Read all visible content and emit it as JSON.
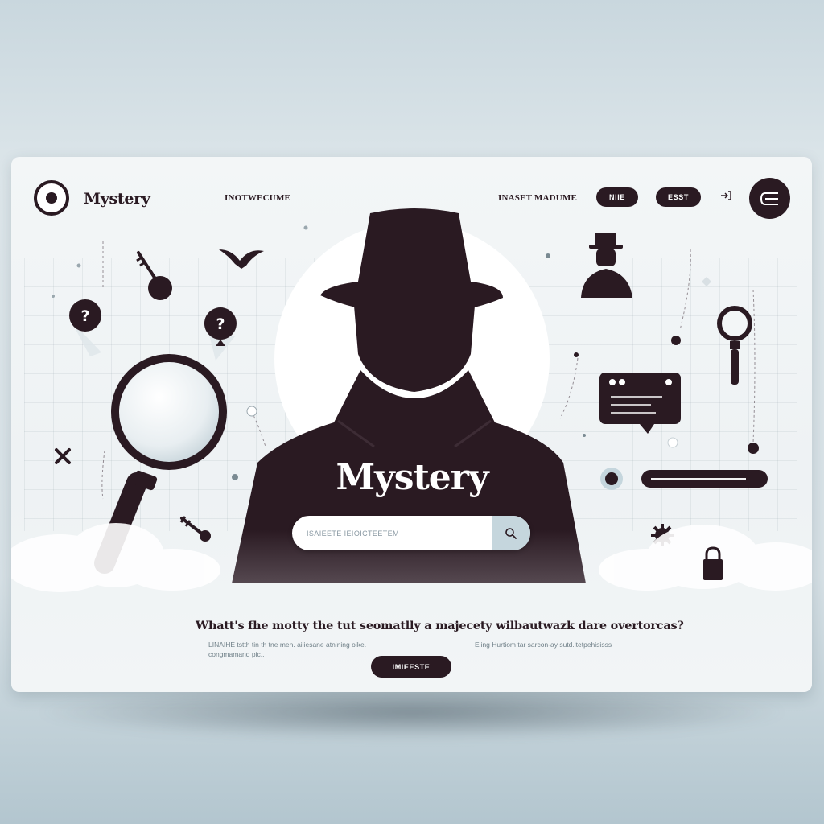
{
  "header": {
    "brand": "Mystery",
    "nav": [
      "INOTWECUME",
      "INASET MADUME"
    ],
    "buttons": [
      "NIIE",
      "ESST"
    ]
  },
  "hero": {
    "title": "Mystery",
    "search_placeholder": "ISAIEETE IEIOICTEETEM"
  },
  "footer": {
    "question": "Whatt's fhe motty the tut seomatlly a majecety wilbautwazk dare overtorcas?",
    "desc_left": "LINAIHE tstth tin th tne men. aiiiesane atnining oike. congmamand pic..",
    "desc_right": "Eling Hurtiom tar sarcon-ay sutd.ltetpehisisss",
    "cta": "IMIEESTE"
  },
  "icons": [
    "logo-icon",
    "login-icon",
    "menu-icon",
    "search-icon",
    "magnifier-icon",
    "key-icon",
    "question-pin-icon",
    "bird-icon",
    "detective-icon",
    "chat-icon",
    "gear-icon",
    "lock-icon",
    "x-icon"
  ],
  "colors": {
    "ink": "#2a1a22",
    "panel": "#f3f6f7",
    "accent": "#c5d6dd",
    "background": "#d7e1e6"
  }
}
